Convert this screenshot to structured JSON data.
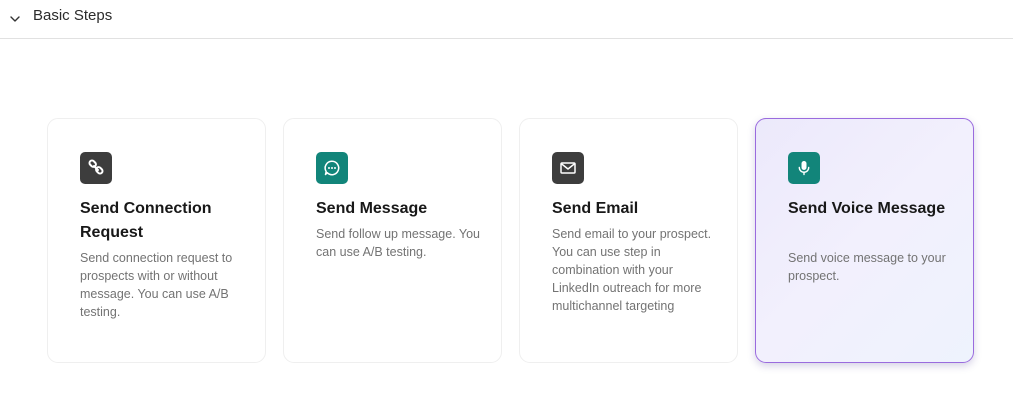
{
  "section": {
    "title": "Basic Steps"
  },
  "colors": {
    "dark_icon_bg": "#3d3d3d",
    "teal_icon_bg": "#12857a",
    "active_border": "#9a6bde",
    "description_text": "#737373"
  },
  "cards": [
    {
      "title": "Send Connection Request",
      "description": "Send connection request to prospects with or without message. You can use A/B testing.",
      "icon": "link-icon",
      "selected": false
    },
    {
      "title": "Send Message",
      "description": "Send follow up message. You can use A/B testing.",
      "icon": "chat-bubble-icon",
      "selected": false
    },
    {
      "title": "Send Email",
      "description": "Send email to your prospect. You can use step in combination with your LinkedIn outreach for more multichannel targeting",
      "icon": "envelope-icon",
      "selected": false
    },
    {
      "title": "Send Voice Message",
      "description": "Send voice message to your prospect.",
      "icon": "microphone-icon",
      "selected": true
    }
  ]
}
